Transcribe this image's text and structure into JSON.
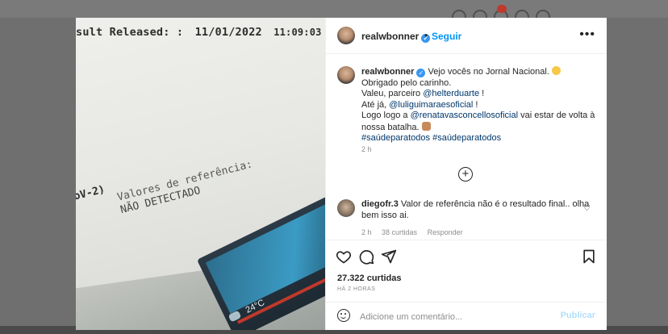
{
  "photo": {
    "result_label": "sult Released: :",
    "result_date": "11/01/2022",
    "result_time": "11:09:03",
    "covid_label": "oV-2)",
    "ref_label": "Valores de referência:",
    "ref_value": "NÃO DETECTADO",
    "laptop_temp": "24°C"
  },
  "post": {
    "header": {
      "username": "realwbonner",
      "separator": "•",
      "follow_label": "Seguir",
      "more_label": "•••"
    },
    "caption": {
      "username": "realwbonner",
      "line1": "Vejo vocês no Jornal Nacional.",
      "line2": "Obrigado pelo carinho.",
      "line3_prefix": "Valeu, parceiro ",
      "line3_mention": "@helterduarte",
      "line3_suffix": " !",
      "line4_prefix": "Até já, ",
      "line4_mention": "@luliguimaraesoficial",
      "line4_suffix": " !",
      "line5_prefix": "Logo logo a ",
      "line5_mention": "@renatavasconcellosoficial",
      "line5_suffix": " vai estar de volta à nossa batalha.",
      "hashtag1": "#saúdeparatodos",
      "hashtag2": "#saúdeparatodos",
      "time": "2 h"
    },
    "comment": {
      "username": "diegofr.3",
      "text": "Valor de referência não é o resultado final.. olha bem isso ai.",
      "time": "2 h",
      "likes": "38 curtidas",
      "reply_label": "Responder"
    },
    "likes_count": "27.322 curtidas",
    "posted_ago": "HÁ 2 HORAS",
    "add_comment": {
      "placeholder": "Adicione um comentário...",
      "publish_label": "Publicar"
    }
  },
  "colors": {
    "link": "#00376b",
    "follow": "#0095f6",
    "verified": "#3897f0",
    "publish_disabled": "#b2dffc"
  },
  "icons": [
    "more-options-icon",
    "verified-badge-icon",
    "load-more-icon",
    "heart-icon",
    "comment-icon",
    "share-icon",
    "bookmark-icon",
    "emoji-icon"
  ]
}
